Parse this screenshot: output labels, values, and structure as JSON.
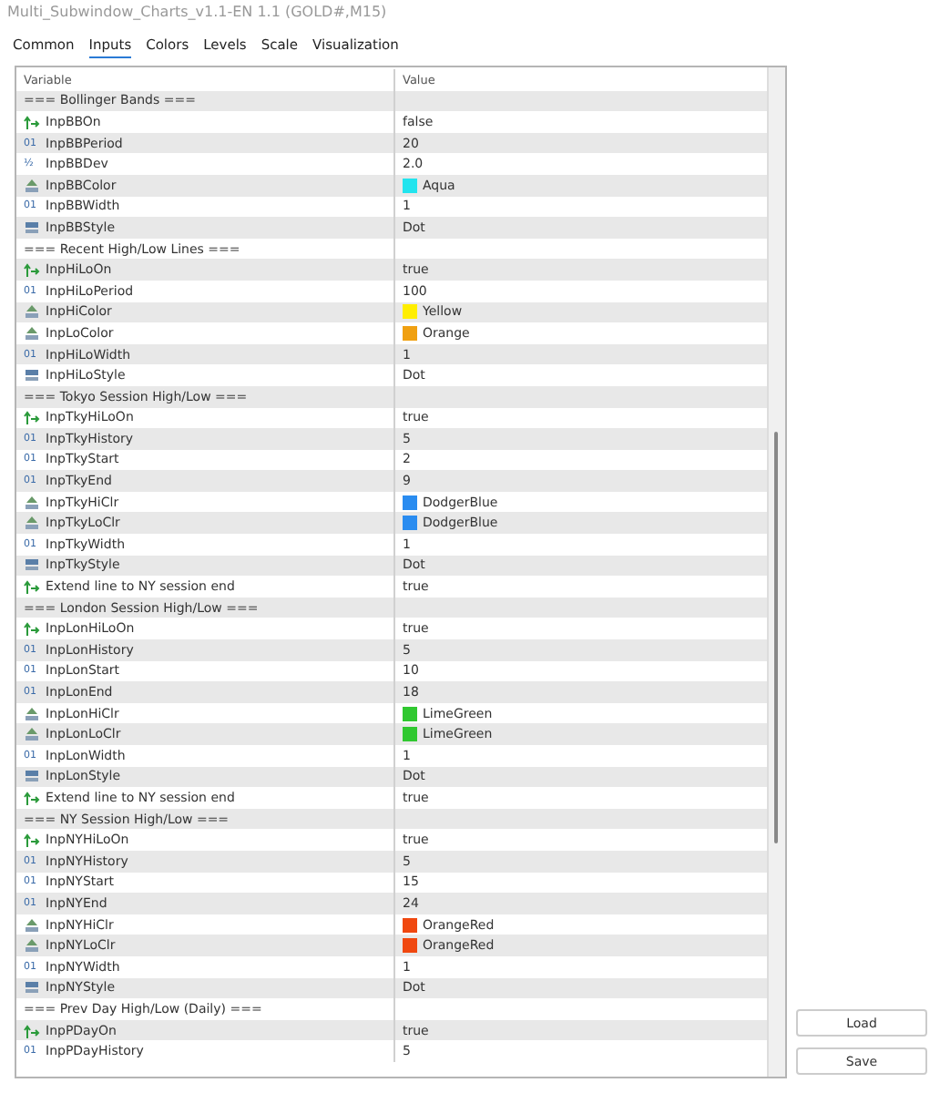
{
  "window": {
    "title": "Multi_Subwindow_Charts_v1.1-EN 1.1 (GOLD#,M15)"
  },
  "tabs": [
    {
      "label": "Common",
      "selected": false
    },
    {
      "label": "Inputs",
      "selected": true
    },
    {
      "label": "Colors",
      "selected": false
    },
    {
      "label": "Levels",
      "selected": false
    },
    {
      "label": "Scale",
      "selected": false
    },
    {
      "label": "Visualization",
      "selected": false
    }
  ],
  "table": {
    "columns": [
      "Variable",
      "Value"
    ],
    "rows": [
      {
        "kind": "section",
        "variable": "=== Bollinger Bands ==="
      },
      {
        "kind": "bool",
        "variable": "InpBBOn",
        "value": "false"
      },
      {
        "kind": "int",
        "badge": "01",
        "variable": "InpBBPeriod",
        "value": "20"
      },
      {
        "kind": "double",
        "badge": "½",
        "variable": "InpBBDev",
        "value": "2.0"
      },
      {
        "kind": "color",
        "variable": "InpBBColor",
        "value": "Aqua",
        "color": "#22e4ee"
      },
      {
        "kind": "int",
        "badge": "01",
        "variable": "InpBBWidth",
        "value": "1"
      },
      {
        "kind": "style",
        "variable": "InpBBStyle",
        "value": "Dot"
      },
      {
        "kind": "section",
        "variable": "=== Recent High/Low Lines ==="
      },
      {
        "kind": "bool",
        "variable": "InpHiLoOn",
        "value": "true"
      },
      {
        "kind": "int",
        "badge": "01",
        "variable": "InpHiLoPeriod",
        "value": "100"
      },
      {
        "kind": "color",
        "variable": "InpHiColor",
        "value": "Yellow",
        "color": "#ffee00"
      },
      {
        "kind": "color",
        "variable": "InpLoColor",
        "value": "Orange",
        "color": "#f0a010"
      },
      {
        "kind": "int",
        "badge": "01",
        "variable": "InpHiLoWidth",
        "value": "1"
      },
      {
        "kind": "style",
        "variable": "InpHiLoStyle",
        "value": "Dot"
      },
      {
        "kind": "section",
        "variable": "=== Tokyo Session High/Low ==="
      },
      {
        "kind": "bool",
        "variable": "InpTkyHiLoOn",
        "value": "true"
      },
      {
        "kind": "int",
        "badge": "01",
        "variable": "InpTkyHistory",
        "value": "5"
      },
      {
        "kind": "int",
        "badge": "01",
        "variable": "InpTkyStart",
        "value": "2"
      },
      {
        "kind": "int",
        "badge": "01",
        "variable": "InpTkyEnd",
        "value": "9"
      },
      {
        "kind": "color",
        "variable": "InpTkyHiClr",
        "value": "DodgerBlue",
        "color": "#2a8cf0"
      },
      {
        "kind": "color",
        "variable": "InpTkyLoClr",
        "value": "DodgerBlue",
        "color": "#2a8cf0"
      },
      {
        "kind": "int",
        "badge": "01",
        "variable": "InpTkyWidth",
        "value": "1"
      },
      {
        "kind": "style",
        "variable": "InpTkyStyle",
        "value": "Dot"
      },
      {
        "kind": "bool",
        "variable": "Extend line to NY session end",
        "value": "true"
      },
      {
        "kind": "section",
        "variable": "=== London Session High/Low ==="
      },
      {
        "kind": "bool",
        "variable": "InpLonHiLoOn",
        "value": "true"
      },
      {
        "kind": "int",
        "badge": "01",
        "variable": "InpLonHistory",
        "value": "5"
      },
      {
        "kind": "int",
        "badge": "01",
        "variable": "InpLonStart",
        "value": "10"
      },
      {
        "kind": "int",
        "badge": "01",
        "variable": "InpLonEnd",
        "value": "18"
      },
      {
        "kind": "color",
        "variable": "InpLonHiClr",
        "value": "LimeGreen",
        "color": "#30c830"
      },
      {
        "kind": "color",
        "variable": "InpLonLoClr",
        "value": "LimeGreen",
        "color": "#30c830"
      },
      {
        "kind": "int",
        "badge": "01",
        "variable": "InpLonWidth",
        "value": "1"
      },
      {
        "kind": "style",
        "variable": "InpLonStyle",
        "value": "Dot"
      },
      {
        "kind": "bool",
        "variable": "Extend line to NY session end",
        "value": "true"
      },
      {
        "kind": "section",
        "variable": "=== NY Session High/Low ==="
      },
      {
        "kind": "bool",
        "variable": "InpNYHiLoOn",
        "value": "true"
      },
      {
        "kind": "int",
        "badge": "01",
        "variable": "InpNYHistory",
        "value": "5"
      },
      {
        "kind": "int",
        "badge": "01",
        "variable": "InpNYStart",
        "value": "15"
      },
      {
        "kind": "int",
        "badge": "01",
        "variable": "InpNYEnd",
        "value": "24"
      },
      {
        "kind": "color",
        "variable": "InpNYHiClr",
        "value": "OrangeRed",
        "color": "#f04810"
      },
      {
        "kind": "color",
        "variable": "InpNYLoClr",
        "value": "OrangeRed",
        "color": "#f04810"
      },
      {
        "kind": "int",
        "badge": "01",
        "variable": "InpNYWidth",
        "value": "1"
      },
      {
        "kind": "style",
        "variable": "InpNYStyle",
        "value": "Dot"
      },
      {
        "kind": "section",
        "variable": "=== Prev Day High/Low (Daily) ==="
      },
      {
        "kind": "bool",
        "variable": "InpPDayOn",
        "value": "true"
      },
      {
        "kind": "int",
        "badge": "01",
        "variable": "InpPDayHistory",
        "value": "5"
      }
    ]
  },
  "buttons": [
    {
      "label": "Load"
    },
    {
      "label": "Save"
    }
  ]
}
